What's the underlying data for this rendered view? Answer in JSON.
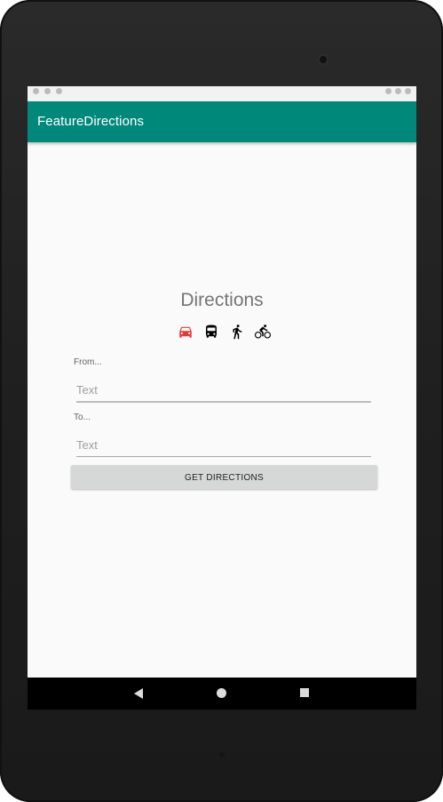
{
  "app": {
    "title": "FeatureDirections"
  },
  "main": {
    "heading": "Directions",
    "modes": [
      {
        "id": "car",
        "icon": "car-icon",
        "selected": true,
        "color": "#e53935"
      },
      {
        "id": "bus",
        "icon": "bus-icon",
        "selected": false,
        "color": "#000000"
      },
      {
        "id": "walk",
        "icon": "walk-icon",
        "selected": false,
        "color": "#000000"
      },
      {
        "id": "bike",
        "icon": "bike-icon",
        "selected": false,
        "color": "#000000"
      }
    ],
    "from": {
      "label": "From...",
      "placeholder": "Text",
      "value": ""
    },
    "to": {
      "label": "To...",
      "placeholder": "Text",
      "value": ""
    },
    "button_label": "GET DIRECTIONS"
  },
  "colors": {
    "app_bar": "#00897b",
    "accent_selected": "#e53935"
  },
  "nav": {
    "icons": [
      "back-icon",
      "home-icon",
      "recents-icon"
    ]
  }
}
